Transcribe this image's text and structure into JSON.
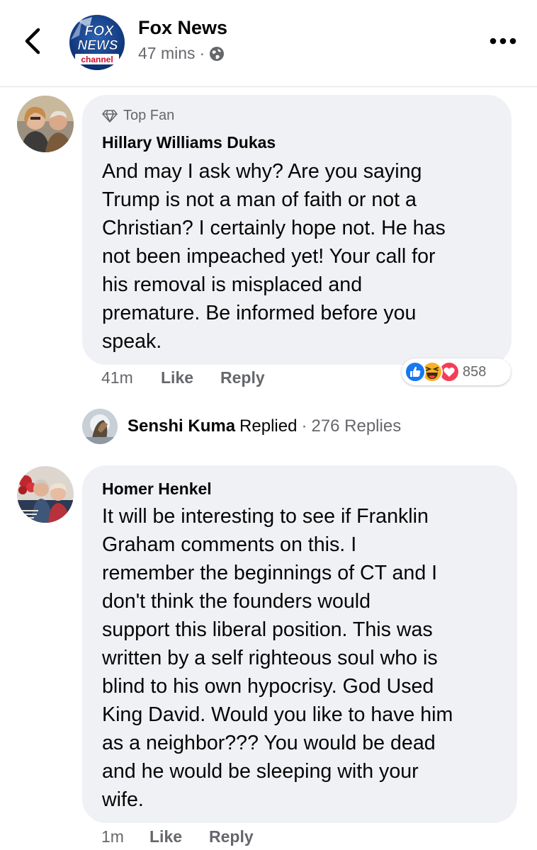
{
  "header": {
    "page_name": "Fox News",
    "time": "47 mins",
    "separator": "·",
    "logo": {
      "line1": "FOX",
      "line2": "NEWS",
      "line3": "channel"
    },
    "icons": {
      "back": "chevron-left-icon",
      "privacy": "globe-icon",
      "more": "more-dots-icon"
    }
  },
  "comments": [
    {
      "badge": "Top Fan",
      "author": "Hillary Williams Dukas",
      "text": "And may I ask why? Are you saying\nTrump is not a man of faith or not a\nChristian? I certainly hope not. He has\nnot been impeached yet! Your call for\nhis removal is misplaced and\npremature. Be informed before you\nspeak.",
      "time": "41m",
      "like": "Like",
      "reply": "Reply",
      "reactions": {
        "icons": [
          "like-reaction-icon",
          "haha-reaction-icon",
          "love-reaction-icon"
        ],
        "count": "858"
      },
      "replies_preview": {
        "name": "Senshi Kuma",
        "action": "Replied",
        "separator": "·",
        "count": "276 Replies"
      }
    },
    {
      "author": "Homer Henkel",
      "text": "It will be interesting to see if Franklin\nGraham comments on this. I\nremember the beginnings of CT and I\ndon't think the founders would\nsupport this liberal position. This was\nwritten by a self righteous soul who is\nblind to his own hypocrisy. God Used\nKing David. Would you like to have him\nas a neighbor??? You would be dead\nand he would be sleeping with your\nwife.",
      "time": "1m",
      "like": "Like",
      "reply": "Reply"
    }
  ],
  "colors": {
    "bubble": "#eff1f4",
    "secondary_text": "#65676b",
    "like_blue": "#1877f2",
    "love_red": "#f33e58",
    "haha_yellow": "#f7b125"
  }
}
